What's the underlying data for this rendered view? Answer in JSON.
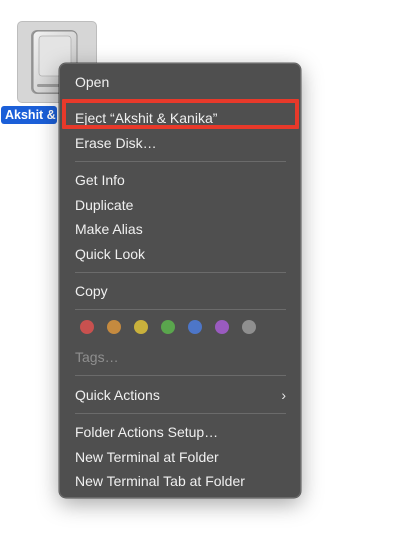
{
  "desktop": {
    "drive_label": "Akshit &",
    "drive_icon": "external-drive-icon"
  },
  "menu": {
    "open": "Open",
    "eject": "Eject “Akshit & Kanika”",
    "erase_disk": "Erase Disk…",
    "get_info": "Get Info",
    "duplicate": "Duplicate",
    "make_alias": "Make Alias",
    "quick_look": "Quick Look",
    "copy": "Copy",
    "tags": "Tags…",
    "quick_actions": "Quick Actions",
    "quick_actions_chevron": "›",
    "folder_actions_setup": "Folder Actions Setup…",
    "new_terminal_at_folder": "New Terminal at Folder",
    "new_terminal_tab_at_folder": "New Terminal Tab at Folder"
  },
  "tag_colors": {
    "red": "#c8514f",
    "orange": "#c58a3f",
    "yellow": "#c9b13c",
    "green": "#5aa64d",
    "blue": "#4d76c8",
    "purple": "#9a5bc0",
    "gray": "#8f8f8f"
  },
  "highlight_color": "#e8392a"
}
